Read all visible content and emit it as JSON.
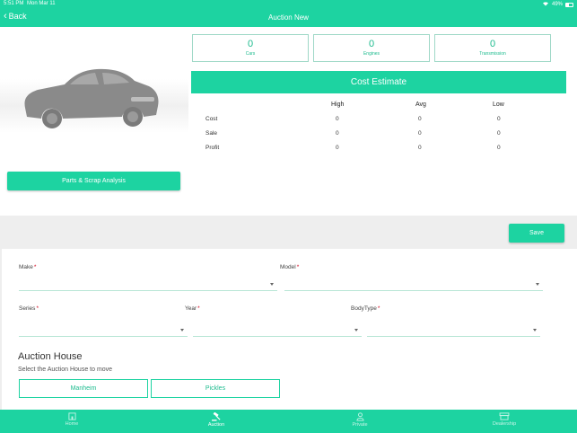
{
  "status_bar": {
    "time": "5:51 PM",
    "date": "Mon Mar 11",
    "battery": "49%"
  },
  "nav": {
    "back_label": "Back",
    "title": "Auction New"
  },
  "stats": [
    {
      "value": "0",
      "label": "Cars"
    },
    {
      "value": "0",
      "label": "Engines"
    },
    {
      "value": "0",
      "label": "Transmission"
    }
  ],
  "cost_estimate": {
    "title": "Cost Estimate",
    "columns": [
      "High",
      "Avg",
      "Low"
    ],
    "rows": [
      {
        "label": "Cost",
        "values": [
          "0",
          "0",
          "0"
        ]
      },
      {
        "label": "Sale",
        "values": [
          "0",
          "0",
          "0"
        ]
      },
      {
        "label": "Profit",
        "values": [
          "0",
          "0",
          "0"
        ]
      }
    ]
  },
  "parts_button_label": "Parts & Scrap Analysis",
  "save_label": "Save",
  "form": {
    "make_label": "Make",
    "model_label": "Model",
    "series_label": "Series",
    "year_label": "Year",
    "bodytype_label": "BodyType",
    "required_mark": "*",
    "make_value": "",
    "model_value": "",
    "series_value": "",
    "year_value": "",
    "bodytype_value": ""
  },
  "auction_house": {
    "title": "Auction House",
    "subtitle": "Select the Auction House to move",
    "options": [
      "Manheim",
      "Pickles"
    ]
  },
  "tabs": [
    {
      "label": "Home",
      "icon": "home-icon"
    },
    {
      "label": "Auction",
      "icon": "gavel-icon"
    },
    {
      "label": "Private",
      "icon": "person-icon"
    },
    {
      "label": "Dealership",
      "icon": "store-icon"
    }
  ],
  "colors": {
    "accent": "#1dd3a1",
    "required": "#d0021b"
  }
}
